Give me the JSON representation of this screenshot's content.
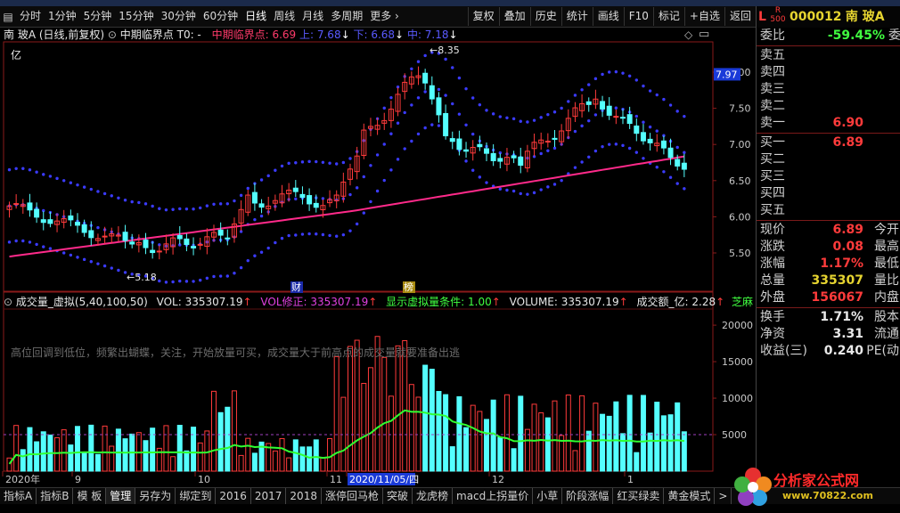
{
  "toolbar": {
    "periods": [
      "分时",
      "1分钟",
      "5分钟",
      "15分钟",
      "30分钟",
      "60分钟",
      "日线",
      "周线",
      "月线",
      "多周期",
      "更多"
    ],
    "active_period": "日线",
    "buttons": [
      "复权",
      "叠加",
      "历史",
      "统计",
      "画线",
      "F10",
      "标记",
      "+自选",
      "返回"
    ]
  },
  "title": {
    "stock": "南 玻A",
    "mode": "(日线,前复权)",
    "indicator": "中期临界点",
    "t0": "T0: -",
    "critical": "中期临界点: 6.69",
    "upper": "上: 7.68",
    "lower": "下: 6.68",
    "middle": "中: 7.18"
  },
  "unit_label": "亿",
  "price_axis": {
    "ticks": [
      "8.00",
      "7.50",
      "7.00",
      "6.50",
      "6.00",
      "5.50"
    ],
    "current": "7.97"
  },
  "annotations": {
    "high": "8.35",
    "low": "5.18",
    "tag1": "财",
    "tag2": "榜"
  },
  "indicator_line": {
    "name": "成交量_虚拟(5,40,100,50)",
    "vol": "VOL: 335307.19",
    "vol_fix": "VOL修正: 335307.19",
    "show_cond": "显示虚拟量条件: 1.00",
    "volume": "VOLUME: 335307.19",
    "amount": "成交额_亿: 2.28",
    "extra": "芝麻"
  },
  "volume_axis": {
    "ticks": [
      "20000",
      "15000",
      "10000",
      "5000"
    ]
  },
  "hint_text": "高位回调到低位，频繁出蝴蝶，关注，开始放量可买，成交量大于前高点的成交量就要准备出逃",
  "date_axis": {
    "labels": [
      "2020年",
      "9",
      "10",
      "11",
      "2020/11/05/四",
      "12",
      "1"
    ]
  },
  "right_panel": {
    "code": "000012",
    "name": "南 玻A",
    "flag_l": "L",
    "flag_r": "R",
    "flag_num": "500",
    "weibi_label": "委比",
    "weibi_value": "-59.45%",
    "weicha_label": "委差",
    "sells": [
      {
        "label": "卖五",
        "value": ""
      },
      {
        "label": "卖四",
        "value": ""
      },
      {
        "label": "卖三",
        "value": ""
      },
      {
        "label": "卖二",
        "value": ""
      },
      {
        "label": "卖一",
        "value": "6.90"
      }
    ],
    "buys": [
      {
        "label": "买一",
        "value": "6.89"
      },
      {
        "label": "买二",
        "value": ""
      },
      {
        "label": "买三",
        "value": ""
      },
      {
        "label": "买四",
        "value": ""
      },
      {
        "label": "买五",
        "value": ""
      }
    ],
    "stats": [
      {
        "label": "现价",
        "value": "6.89",
        "label2": "今开",
        "color": "#ff3b3b"
      },
      {
        "label": "涨跌",
        "value": "0.08",
        "label2": "最高",
        "color": "#ff3b3b"
      },
      {
        "label": "涨幅",
        "value": "1.17%",
        "label2": "最低",
        "color": "#ff3b3b"
      },
      {
        "label": "总量",
        "value": "335307",
        "label2": "量比",
        "color": "#e6d430"
      },
      {
        "label": "外盘",
        "value": "156067",
        "label2": "内盘",
        "color": "#ff3b3b"
      }
    ],
    "stats2": [
      {
        "label": "换手",
        "value": "1.71%",
        "label2": "股本",
        "color": "#e8e8e8"
      },
      {
        "label": "净资",
        "value": "3.31",
        "label2": "流通",
        "color": "#e8e8e8"
      },
      {
        "label": "收益(三)",
        "value": "0.240",
        "label2": "PE(动",
        "color": "#e8e8e8"
      }
    ]
  },
  "bottom_tabs": [
    "指标A",
    "指标B",
    "模 板",
    "管理",
    "另存为",
    "绑定到",
    "2016",
    "2017",
    "2018",
    "涨停回马枪",
    "突破",
    "龙虎榜",
    "macd上拐量价",
    "小草",
    "阶段涨幅",
    "红买绿卖",
    "黄金模式",
    ">"
  ],
  "active_tab": "管理",
  "watermark": {
    "title": "分析家公式网",
    "url": "www.70822.com"
  },
  "colors": {
    "up": "#ff3b3b",
    "down": "#54ffff",
    "band": "#3b3bff",
    "ma": "#ff2a8a",
    "vol_line": "#30ff30"
  }
}
